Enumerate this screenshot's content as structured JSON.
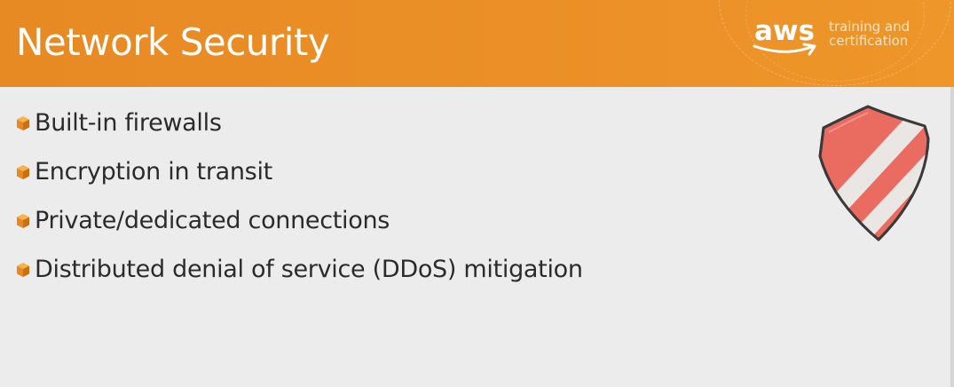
{
  "slide": {
    "title": "Network Security",
    "background_color": "#ececec",
    "header_color": "#eb8f26"
  },
  "logo": {
    "word": "aws",
    "tagline_line1": "training and",
    "tagline_line2": "certification",
    "icon": "aws-smile-arrow-icon"
  },
  "bullets": [
    {
      "icon": "cube-bullet-icon",
      "label": "Built-in firewalls"
    },
    {
      "icon": "cube-bullet-icon",
      "label": "Encryption in transit"
    },
    {
      "icon": "cube-bullet-icon",
      "label": "Private/dedicated connections"
    },
    {
      "icon": "cube-bullet-icon",
      "label": "Distributed denial of service (DDoS) mitigation"
    }
  ],
  "illustration": {
    "icon": "striped-shield-icon",
    "colors": {
      "shield_fill": "#ea6b5f",
      "shield_outline": "#3a3a3a",
      "stripe": "#e9e6e4"
    }
  },
  "bullet_colors": {
    "cube_top": "#f7b24a",
    "cube_left": "#e8891f",
    "cube_right": "#c96f14"
  }
}
